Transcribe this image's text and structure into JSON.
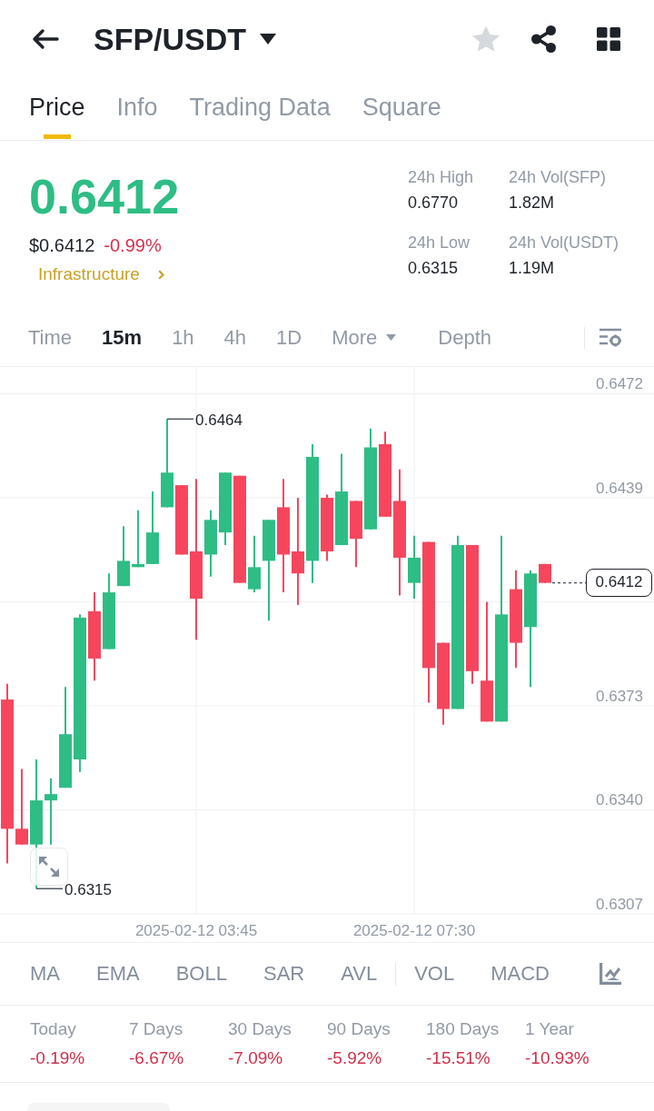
{
  "header": {
    "pair": "SFP/USDT",
    "favorited": false
  },
  "tabs": [
    {
      "label": "Price",
      "selected": true
    },
    {
      "label": "Info",
      "selected": false
    },
    {
      "label": "Trading Data",
      "selected": false
    },
    {
      "label": "Square",
      "selected": false
    }
  ],
  "ticker": {
    "price": "0.6412",
    "price_usd": "$0.6412",
    "change": "-0.99%",
    "category": "Infrastructure"
  },
  "stats": [
    {
      "label": "24h High",
      "value": "0.6770"
    },
    {
      "label": "24h Vol(SFP)",
      "value": "1.82M"
    },
    {
      "label": "24h Low",
      "value": "0.6315"
    },
    {
      "label": "24h Vol(USDT)",
      "value": "1.19M"
    }
  ],
  "intervals": [
    {
      "label": "Time",
      "kind": "interval",
      "selected": false
    },
    {
      "label": "15m",
      "kind": "interval",
      "selected": true
    },
    {
      "label": "1h",
      "kind": "interval",
      "selected": false
    },
    {
      "label": "4h",
      "kind": "interval",
      "selected": false
    },
    {
      "label": "1D",
      "kind": "interval",
      "selected": false
    },
    {
      "label": "More",
      "kind": "menu",
      "selected": false
    },
    {
      "label": "Depth",
      "kind": "view",
      "selected": false
    }
  ],
  "chart": {
    "chart_data": {
      "type": "candlestick",
      "categories": [
        null,
        null,
        null,
        null,
        null,
        null,
        null,
        null,
        null,
        null,
        null,
        null,
        null,
        "2025-02-12 03:45",
        null,
        null,
        null,
        null,
        null,
        null,
        null,
        null,
        null,
        null,
        null,
        null,
        null,
        null,
        "2025-02-12 07:30",
        null,
        null,
        null,
        null,
        null,
        null,
        null,
        null,
        null
      ],
      "ohlc": [
        [
          0.6375,
          0.638,
          0.6323,
          0.6334
        ],
        [
          0.6334,
          0.6353,
          0.6329,
          0.6329
        ],
        [
          0.6329,
          0.6356,
          0.6315,
          0.6343
        ],
        [
          0.6343,
          0.635,
          0.6329,
          0.6345
        ],
        [
          0.6347,
          0.6379,
          0.6347,
          0.6364
        ],
        [
          0.6356,
          0.6402,
          0.6352,
          0.6401
        ],
        [
          0.6403,
          0.6409,
          0.6381,
          0.6388
        ],
        [
          0.6391,
          0.6415,
          0.6391,
          0.6409
        ],
        [
          0.6411,
          0.643,
          0.6411,
          0.6419
        ],
        [
          0.6417,
          0.6435,
          0.6417,
          0.6418
        ],
        [
          0.6418,
          0.6441,
          0.6418,
          0.6428
        ],
        [
          0.6436,
          0.6464,
          0.6436,
          0.6447
        ],
        [
          0.6443,
          0.6443,
          0.6421,
          0.6421
        ],
        [
          0.6422,
          0.6445,
          0.6394,
          0.6407
        ],
        [
          0.6421,
          0.6435,
          0.6414,
          0.6432
        ],
        [
          0.6428,
          0.6447,
          0.6424,
          0.6447
        ],
        [
          0.6446,
          0.6446,
          0.6412,
          0.6412
        ],
        [
          0.641,
          0.6427,
          0.6409,
          0.6417
        ],
        [
          0.6419,
          0.6432,
          0.64,
          0.6432
        ],
        [
          0.6436,
          0.6445,
          0.6409,
          0.6421
        ],
        [
          0.6422,
          0.6439,
          0.6405,
          0.6415
        ],
        [
          0.6419,
          0.6456,
          0.6412,
          0.6452
        ],
        [
          0.6439,
          0.644,
          0.6419,
          0.6422
        ],
        [
          0.6424,
          0.6453,
          0.6424,
          0.6441
        ],
        [
          0.6438,
          0.6438,
          0.6417,
          0.6426
        ],
        [
          0.6429,
          0.6461,
          0.6429,
          0.6455
        ],
        [
          0.6456,
          0.646,
          0.6433,
          0.6433
        ],
        [
          0.6438,
          0.6448,
          0.6408,
          0.642
        ],
        [
          0.6412,
          0.6427,
          0.6407,
          0.642
        ],
        [
          0.6425,
          0.6425,
          0.6374,
          0.6385
        ],
        [
          0.6393,
          0.6393,
          0.6367,
          0.6372
        ],
        [
          0.6372,
          0.6427,
          0.6372,
          0.6424
        ],
        [
          0.6424,
          0.6424,
          0.638,
          0.6384
        ],
        [
          0.6381,
          0.6406,
          0.6368,
          0.6368
        ],
        [
          0.6368,
          0.6427,
          0.6368,
          0.6402
        ],
        [
          0.641,
          0.6416,
          0.6385,
          0.6393
        ],
        [
          0.6398,
          0.6416,
          0.6379,
          0.6415
        ],
        [
          0.6418,
          0.6418,
          0.6412,
          0.6412
        ]
      ],
      "ylim": [
        0.6307,
        0.64805
      ],
      "yticks": [
        {
          "value": 0.6307,
          "label": "0.6307"
        },
        {
          "value": 0.634,
          "label": "0.6340"
        },
        {
          "value": 0.6373,
          "label": "0.6373"
        },
        {
          "value": 0.6439,
          "label": "0.6439"
        },
        {
          "value": 0.6472,
          "label": "0.6472"
        }
      ],
      "grid": true,
      "annotations": [
        "0.6464",
        "0.6315",
        "0.6412"
      ]
    }
  },
  "indicators": {
    "main": [
      "MA",
      "EMA",
      "BOLL",
      "SAR",
      "AVL"
    ],
    "sub": [
      "VOL",
      "MACD"
    ]
  },
  "performance": [
    {
      "period": "Today",
      "change": "-0.19%"
    },
    {
      "period": "7 Days",
      "change": "-6.67%"
    },
    {
      "period": "30 Days",
      "change": "-7.09%"
    },
    {
      "period": "90 Days",
      "change": "-5.92%"
    },
    {
      "period": "180 Days",
      "change": "-15.51%"
    },
    {
      "period": "1 Year",
      "change": "-10.93%"
    }
  ]
}
